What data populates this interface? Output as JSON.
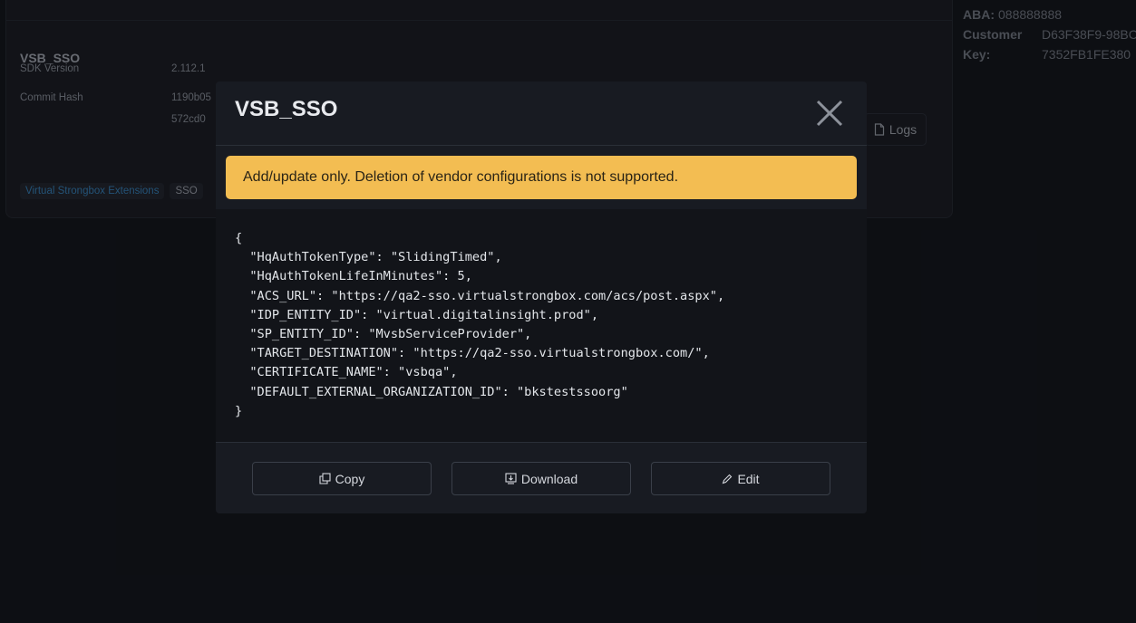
{
  "background": {
    "card_title": "VSB_SSO",
    "rows": [
      {
        "label": "SDK Version",
        "value": "2.112.1"
      },
      {
        "label": "Commit Hash",
        "value": "1190b05",
        "value2": "572cd0"
      }
    ],
    "tags": [
      "Virtual Strongbox Extensions",
      "SSO"
    ],
    "logs_label": "Logs",
    "side": [
      {
        "label": "ABA:",
        "value": "088888888"
      },
      {
        "label": "Customer",
        "value": "D63F38F9-98BC"
      },
      {
        "label": "Key:",
        "value": "7352FB1FE380"
      }
    ]
  },
  "modal": {
    "title": "VSB_SSO",
    "alert": "Add/update only. Deletion of vendor configurations is not supported.",
    "code_lines": [
      "{",
      "  \"HqAuthTokenType\": \"SlidingTimed\",",
      "  \"HqAuthTokenLifeInMinutes\": 5,",
      "  \"ACS_URL\": \"https://qa2-sso.virtualstrongbox.com/acs/post.aspx\",",
      "  \"IDP_ENTITY_ID\": \"virtual.digitalinsight.prod\",",
      "  \"SP_ENTITY_ID\": \"MvsbServiceProvider\",",
      "  \"TARGET_DESTINATION\": \"https://qa2-sso.virtualstrongbox.com/\",",
      "  \"CERTIFICATE_NAME\": \"vsbqa\",",
      "  \"DEFAULT_EXTERNAL_ORGANIZATION_ID\": \"bkstestssoorg\"",
      "}"
    ],
    "buttons": {
      "copy": "Copy",
      "download": "Download",
      "edit": "Edit"
    },
    "icons": {
      "close": "close-icon",
      "copy": "copy-icon",
      "download": "download-icon",
      "edit": "pencil-icon",
      "logs": "file-icon"
    }
  },
  "colors": {
    "alert_bg": "#f3bd52",
    "page_bg": "#12141a",
    "modal_bg": "#181b22",
    "code_bg": "#121419",
    "tag_blue": "#3a8fcf"
  }
}
